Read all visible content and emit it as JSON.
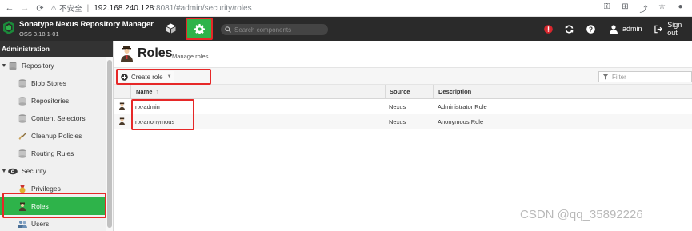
{
  "browser": {
    "insecure_label": "不安全",
    "separator": "|",
    "host": "192.168.240.128",
    "path": ":8081/#admin/security/roles"
  },
  "header": {
    "title": "Sonatype Nexus Repository Manager",
    "version": "OSS 3.18.1-01",
    "search_placeholder": "Search components",
    "user": "admin",
    "signout": "Sign out"
  },
  "sidebar": {
    "title": "Administration",
    "items": [
      {
        "label": "Repository",
        "type": "group",
        "icon": "database-icon"
      },
      {
        "label": "Blob Stores",
        "type": "child",
        "icon": "blob-store-icon"
      },
      {
        "label": "Repositories",
        "type": "child",
        "icon": "repository-icon"
      },
      {
        "label": "Content Selectors",
        "type": "child",
        "icon": "content-selector-icon"
      },
      {
        "label": "Cleanup Policies",
        "type": "child",
        "icon": "broom-icon"
      },
      {
        "label": "Routing Rules",
        "type": "child",
        "icon": "routing-icon"
      },
      {
        "label": "Security",
        "type": "group",
        "icon": "eye-icon"
      },
      {
        "label": "Privileges",
        "type": "child",
        "icon": "medal-icon"
      },
      {
        "label": "Roles",
        "type": "child",
        "icon": "role-icon",
        "active": true
      },
      {
        "label": "Users",
        "type": "child",
        "icon": "users-icon"
      }
    ]
  },
  "main": {
    "title": "Roles",
    "subtitle": "Manage roles",
    "create_label": "Create role",
    "filter_placeholder": "Filter",
    "columns": {
      "name": "Name",
      "source": "Source",
      "description": "Description"
    },
    "sort_indicator": "↑",
    "rows": [
      {
        "name": "nx-admin",
        "source": "Nexus",
        "description": "Administrator Role"
      },
      {
        "name": "nx-anonymous",
        "source": "Nexus",
        "description": "Anonymous Role"
      }
    ]
  },
  "watermark": "CSDN @qq_35892226",
  "colors": {
    "accent": "#2eb34a",
    "highlight": "#e62828",
    "header_bg": "#2a2a2a"
  }
}
